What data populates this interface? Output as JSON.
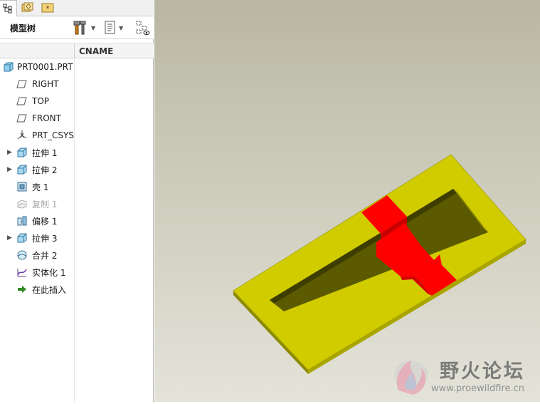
{
  "model_tree": {
    "title": "模型树",
    "column_header": "CNAME",
    "items": [
      {
        "label": "PRT0001.PRT",
        "icon": "part-icon",
        "expandable": false,
        "dimmed": false
      },
      {
        "label": "RIGHT",
        "icon": "datum-plane-icon",
        "expandable": false,
        "dimmed": false
      },
      {
        "label": "TOP",
        "icon": "datum-plane-icon",
        "expandable": false,
        "dimmed": false
      },
      {
        "label": "FRONT",
        "icon": "datum-plane-icon",
        "expandable": false,
        "dimmed": false
      },
      {
        "label": "PRT_CSYS_",
        "icon": "coordinate-system-icon",
        "expandable": false,
        "dimmed": false
      },
      {
        "label": "拉伸 1",
        "icon": "extrude-icon",
        "expandable": true,
        "dimmed": false
      },
      {
        "label": "拉伸 2",
        "icon": "extrude-icon",
        "expandable": true,
        "dimmed": false
      },
      {
        "label": "壳 1",
        "icon": "shell-icon",
        "expandable": false,
        "dimmed": false
      },
      {
        "label": "复制 1",
        "icon": "copy-icon",
        "expandable": false,
        "dimmed": true
      },
      {
        "label": "偏移 1",
        "icon": "offset-icon",
        "expandable": false,
        "dimmed": false
      },
      {
        "label": "拉伸 3",
        "icon": "extrude-icon",
        "expandable": true,
        "dimmed": false
      },
      {
        "label": "合并 2",
        "icon": "merge-icon",
        "expandable": false,
        "dimmed": false
      },
      {
        "label": "实体化 1",
        "icon": "solidify-icon",
        "expandable": false,
        "dimmed": false
      },
      {
        "label": "在此插入",
        "icon": "insert-here-arrow-icon",
        "expandable": false,
        "dimmed": false
      }
    ]
  },
  "colors": {
    "part_body": "#d0cc00",
    "highlight": "#ff0000",
    "insert_arrow": "#2e8b1f"
  },
  "watermark": {
    "title": "野火论坛",
    "url": "www.proewildfire.cn"
  }
}
